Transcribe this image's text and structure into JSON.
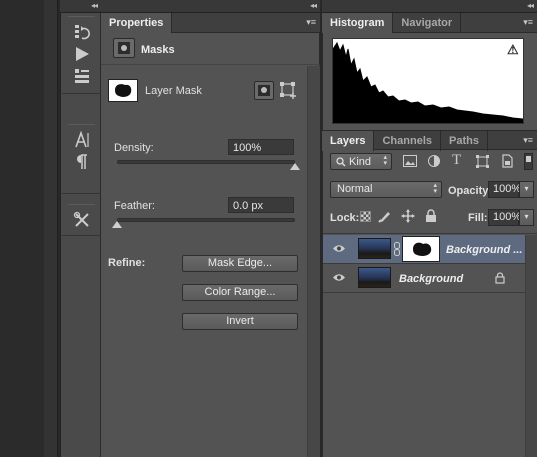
{
  "collapse_arrows": "◂◂",
  "panel_menu_glyph": "▾≡",
  "properties": {
    "tab_label": "Properties",
    "header_title": "Masks",
    "layer_mask_label": "Layer Mask",
    "density_label": "Density:",
    "density_value": "100%",
    "density_level": 1.0,
    "feather_label": "Feather:",
    "feather_value": "0.0 px",
    "feather_level": 0.0,
    "refine_label": "Refine:",
    "mask_edge_label": "Mask Edge...",
    "color_range_label": "Color Range...",
    "invert_label": "Invert"
  },
  "histogram": {
    "tabs": [
      "Histogram",
      "Navigator"
    ],
    "warning_glyph": "⚠"
  },
  "layers": {
    "tabs": [
      "Layers",
      "Channels",
      "Paths"
    ],
    "filter_kind": "Kind",
    "blend_mode": "Normal",
    "opacity_label": "Opacity:",
    "opacity_value": "100%",
    "lock_label": "Lock:",
    "fill_label": "Fill:",
    "fill_value": "100%",
    "items": [
      {
        "name": "Background ...",
        "selected": true,
        "has_mask": true,
        "locked": false
      },
      {
        "name": "Background",
        "selected": false,
        "has_mask": false,
        "locked": true
      }
    ]
  },
  "colors": {
    "selected_row": "#5d6a80",
    "panel_bg": "#535353",
    "dark_bar": "#3f3f3f"
  }
}
